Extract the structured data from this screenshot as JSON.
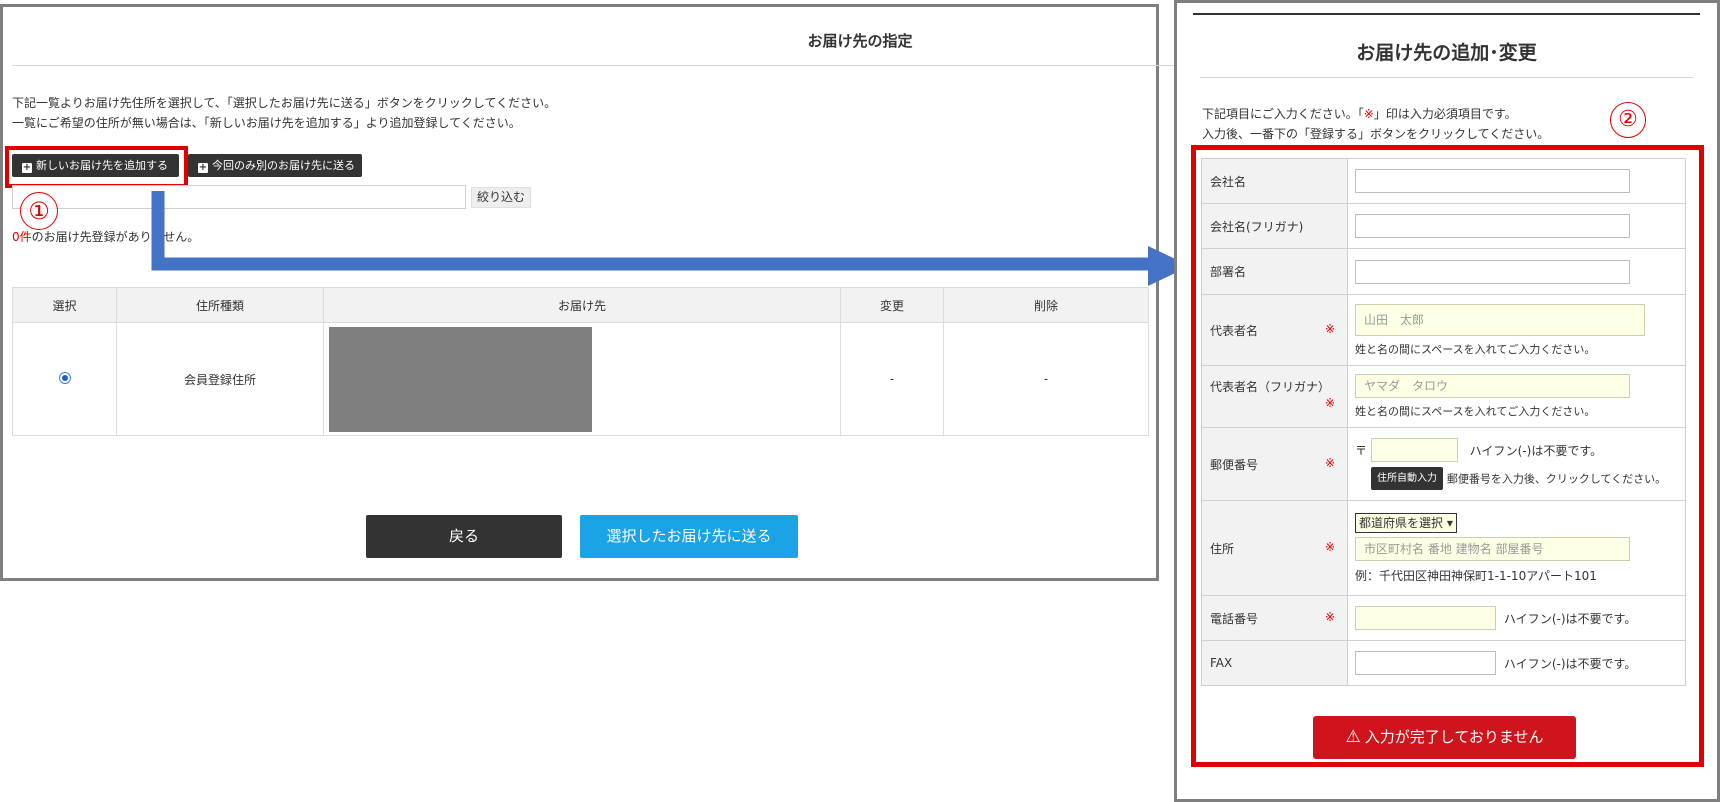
{
  "left": {
    "title": "お届け先の指定",
    "desc_line1": "下記一覧よりお届け先住所を選択して、「選択したお届け先に送る」ボタンをクリックしてください。",
    "desc_line2": "一覧にご希望の住所が無い場合は、「新しいお届け先を追加する」より追加登録してください。",
    "add_button": "新しいお届け先を追加する",
    "once_button": "今回のみ別のお届け先に送る",
    "filter_button": "絞り込む",
    "count_value": "0件",
    "count_text": "のお届け先登録がありません。",
    "marker": "①",
    "table": {
      "headers": [
        "選択",
        "住所種類",
        "お届け先",
        "変更",
        "削除"
      ],
      "row": {
        "type": "会員登録住所",
        "change": "-",
        "delete": "-"
      }
    },
    "back_button": "戻る",
    "send_button": "選択したお届け先に送る"
  },
  "right": {
    "title": "お届け先の追加･変更",
    "desc_line1_a": "下記項目にご入力ください。「",
    "desc_line1_mark": "※",
    "desc_line1_b": "」印は入力必須項目です。",
    "desc_line2": "入力後、一番下の「登録する」ボタンをクリックしてください。",
    "marker": "②",
    "required_mark": "※",
    "fields": {
      "company": "会社名",
      "company_kana": "会社名(フリガナ)",
      "department": "部署名",
      "rep_name": "代表者名",
      "rep_name_placeholder": "山田　太郎",
      "rep_name_note": "姓と名の間にスペースを入れてご入力ください。",
      "rep_kana": "代表者名（フリガナ）",
      "rep_kana_placeholder": "ヤマダ　タロウ",
      "rep_kana_note": "姓と名の間にスペースを入れてご入力ください。",
      "postal": "郵便番号",
      "postal_mark": "〒",
      "postal_hint": "ハイフン(-)は不要です。",
      "auto_fill_button": "住所自動入力",
      "auto_fill_hint": "郵便番号を入力後、クリックしてください。",
      "address": "住所",
      "prefecture_select": "都道府県を選択",
      "address_placeholder": "市区町村名 番地 建物名 部屋番号",
      "address_example": "例：千代田区神田神保町1-1-10アパート101",
      "phone": "電話番号",
      "phone_hint": "ハイフン(-)は不要です。",
      "fax": "FAX",
      "fax_hint": "ハイフン(-)は不要です。"
    },
    "incomplete_button": "入力が完了しておりません"
  },
  "colors": {
    "annotation_red": "#e00000",
    "arrow_blue": "#4472c4",
    "send_blue": "#1aa3e6",
    "incomplete_red": "#d0141b",
    "dark_button": "#333333"
  }
}
